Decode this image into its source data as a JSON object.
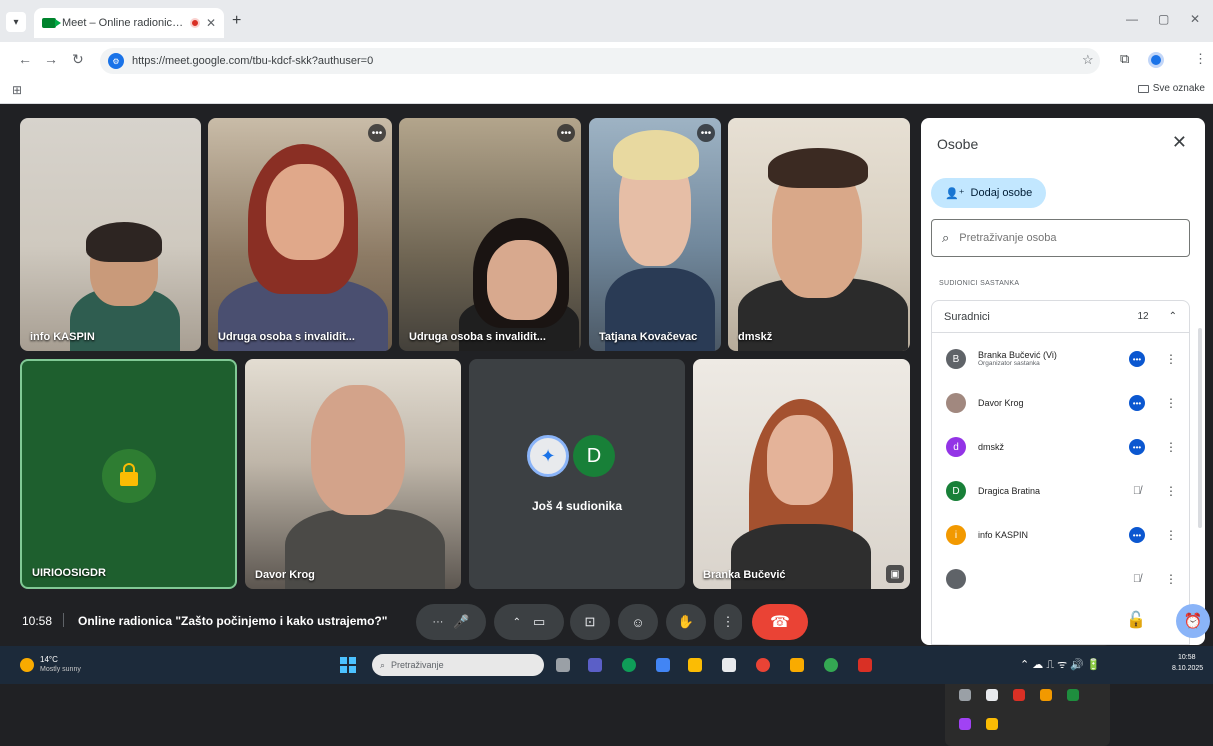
{
  "browser": {
    "tab_title": "Meet – Online radionica \"Z",
    "url": "https://meet.google.com/tbu-kdcf-skk?authuser=0",
    "all_bookmarks": "Sve oznake"
  },
  "tiles": {
    "t1": "info KASPIN",
    "t2": "Udruga osoba s invalidit...",
    "t3": "Udruga osoba s invalidit...",
    "t4": "Tatjana Kovačevac",
    "t5": "dmskž",
    "t6": "UIRIOOSIGDR",
    "t7": "Davor Krog",
    "t8_avatar_letter": "D",
    "t8_label": "Još 4 sudionika",
    "t9": "Branka Bučević"
  },
  "panel": {
    "title": "Osobe",
    "add_label": "Dodaj osobe",
    "search_placeholder": "Pretraživanje osoba",
    "section_label": "SUDIONICI SASTANKA",
    "group_name": "Suradnici",
    "group_count": "12",
    "people": [
      {
        "initial": "B",
        "name": "Branka Bučević (Vi)",
        "sub": "Organizator sastanka",
        "color": "#5f6368"
      },
      {
        "initial": "",
        "name": "Davor Krog",
        "sub": "",
        "color": "#a1887f"
      },
      {
        "initial": "d",
        "name": "dmskž",
        "sub": "",
        "color": "#9334e6"
      },
      {
        "initial": "D",
        "name": "Dragica Bratina",
        "sub": "",
        "color": "#188038"
      },
      {
        "initial": "i",
        "name": "info KASPIN",
        "sub": "",
        "color": "#f29900"
      }
    ]
  },
  "meeting": {
    "time": "10:58",
    "title": "Online radionica \"Zašto počinjemo i kako ustrajemo?\""
  },
  "taskbar": {
    "temp": "14°C",
    "weather": "Mostly sunny",
    "search_placeholder": "Pretraživanje",
    "time": "10:58",
    "date": "8.10.2025"
  },
  "colors": {
    "meet_bg": "#202124",
    "end_call": "#ea4335",
    "panel_accent": "#c2e7ff",
    "tile_lock_bg": "#1e5f2e"
  }
}
